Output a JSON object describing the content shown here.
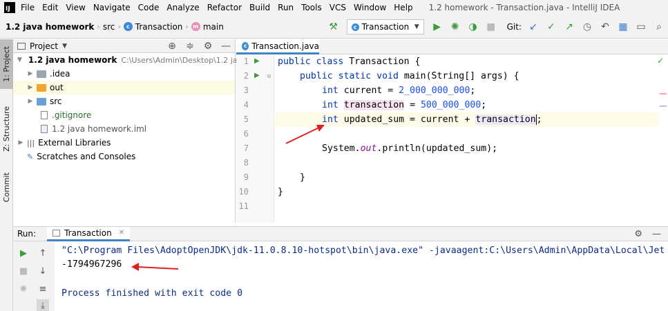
{
  "menu": {
    "items": [
      "File",
      "Edit",
      "View",
      "Navigate",
      "Code",
      "Analyze",
      "Refactor",
      "Build",
      "Run",
      "Tools",
      "VCS",
      "Window",
      "Help"
    ],
    "window_title": "1.2 homework - Transaction.java - IntelliJ IDEA"
  },
  "breadcrumb": {
    "project": "1.2 java homework",
    "folder": "src",
    "class": "Transaction",
    "method": "main"
  },
  "toolbar": {
    "run_config": "Transaction",
    "git_label": "Git:"
  },
  "left_stripe": {
    "project_tab": "1: Project",
    "structure_tab": "Z: Structure",
    "commit_tab": "Commit"
  },
  "project_panel": {
    "title": "Project",
    "root": {
      "name": "1.2 java homework",
      "path": "C:\\Users\\Admin\\Desktop\\1.2 java"
    },
    "children": [
      {
        "name": ".idea",
        "kind": "folder"
      },
      {
        "name": "out",
        "kind": "folder-orange"
      },
      {
        "name": "src",
        "kind": "folder-blue"
      },
      {
        "name": ".gitignore",
        "kind": "file"
      },
      {
        "name": "1.2 java homework.iml",
        "kind": "file"
      }
    ],
    "external_libraries": "External Libraries",
    "scratches": "Scratches and Consoles"
  },
  "editor": {
    "tab_label": "Transaction.java",
    "line_numbers": [
      "1",
      "2",
      "3",
      "4",
      "5",
      "6",
      "7",
      "8",
      "9",
      "10",
      "11"
    ],
    "code": {
      "l1_kw": "public class",
      "l1_rest": " Transaction {",
      "l2_kw": "public static void",
      "l2_rest": " main(String[] args) {",
      "l3_kw": "int",
      "l3_var": " current = ",
      "l3_num": "2_000_000_000",
      "l3_end": ";",
      "l4_kw": "int",
      "l4_var": "transaction",
      "l4_mid": " = ",
      "l4_num": "500_000_000",
      "l4_end": ";",
      "l5_kw": "int",
      "l5_mid": " updated_sum = current + ",
      "l5_var": "transaction",
      "l5_end": ";",
      "l7_start": "System.",
      "l7_out": "out",
      "l7_end": ".println(updated_sum);",
      "l9": "}",
      "l10": "}"
    },
    "colors": {
      "keyword": "#0033b3",
      "number": "#1750eb",
      "static_field": "#871094"
    }
  },
  "run_panel": {
    "label": "Run:",
    "tab": "Transaction",
    "console": {
      "command": "\"C:\\Program Files\\AdoptOpenJDK\\jdk-11.0.8.10-hotspot\\bin\\java.exe\" -javaagent:C:\\Users\\Admin\\AppData\\Local\\Jet",
      "output": "-1794967296",
      "exit_message": "Process finished with exit code 0"
    }
  }
}
